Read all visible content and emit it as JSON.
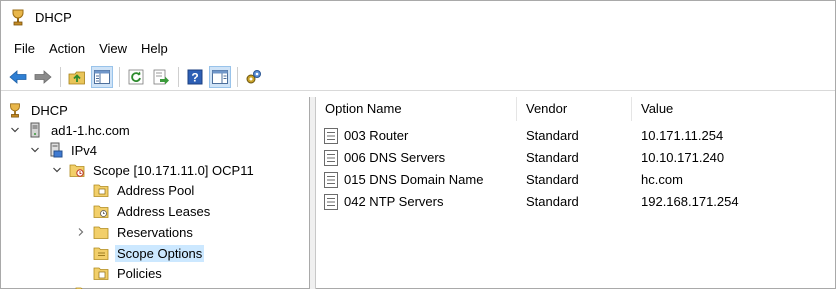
{
  "window": {
    "title": "DHCP"
  },
  "menu": [
    "File",
    "Action",
    "View",
    "Help"
  ],
  "toolbar": [
    {
      "icon": "back-arrow-icon"
    },
    {
      "icon": "forward-arrow-icon"
    },
    {
      "icon": "up-folder-icon"
    },
    {
      "icon": "show-hide-console-tree-icon",
      "pressed": true
    },
    {
      "icon": "refresh-icon"
    },
    {
      "icon": "export-list-icon"
    },
    {
      "icon": "help-icon"
    },
    {
      "icon": "show-action-pane-icon",
      "pressed": true
    },
    {
      "icon": "dhcp-options-icon"
    }
  ],
  "tree": [
    {
      "label": "DHCP",
      "icon": "dhcp-icon"
    },
    {
      "label": "ad1-1.hc.com",
      "icon": "server-icon",
      "expanded": true
    },
    {
      "label": "IPv4",
      "icon": "ipv4-icon",
      "expanded": true
    },
    {
      "label": "Scope [10.171.11.0] OCP11",
      "icon": "scope-folder-icon",
      "expanded": true
    },
    {
      "label": "Address Pool",
      "icon": "folder-icon"
    },
    {
      "label": "Address Leases",
      "icon": "folder-icon"
    },
    {
      "label": "Reservations",
      "icon": "folder-icon",
      "collapsed": true
    },
    {
      "label": "Scope Options",
      "icon": "folder-icon",
      "selected": true
    },
    {
      "label": "Policies",
      "icon": "folder-icon"
    }
  ],
  "list": {
    "headers": {
      "name": "Option Name",
      "vendor": "Vendor",
      "value": "Value"
    },
    "rows": [
      {
        "name": "003 Router",
        "vendor": "Standard",
        "value": "10.171.11.254"
      },
      {
        "name": "006 DNS Servers",
        "vendor": "Standard",
        "value": "10.10.171.240"
      },
      {
        "name": "015 DNS Domain Name",
        "vendor": "Standard",
        "value": "hc.com"
      },
      {
        "name": "042 NTP Servers",
        "vendor": "Standard",
        "value": "192.168.171.254"
      }
    ]
  }
}
